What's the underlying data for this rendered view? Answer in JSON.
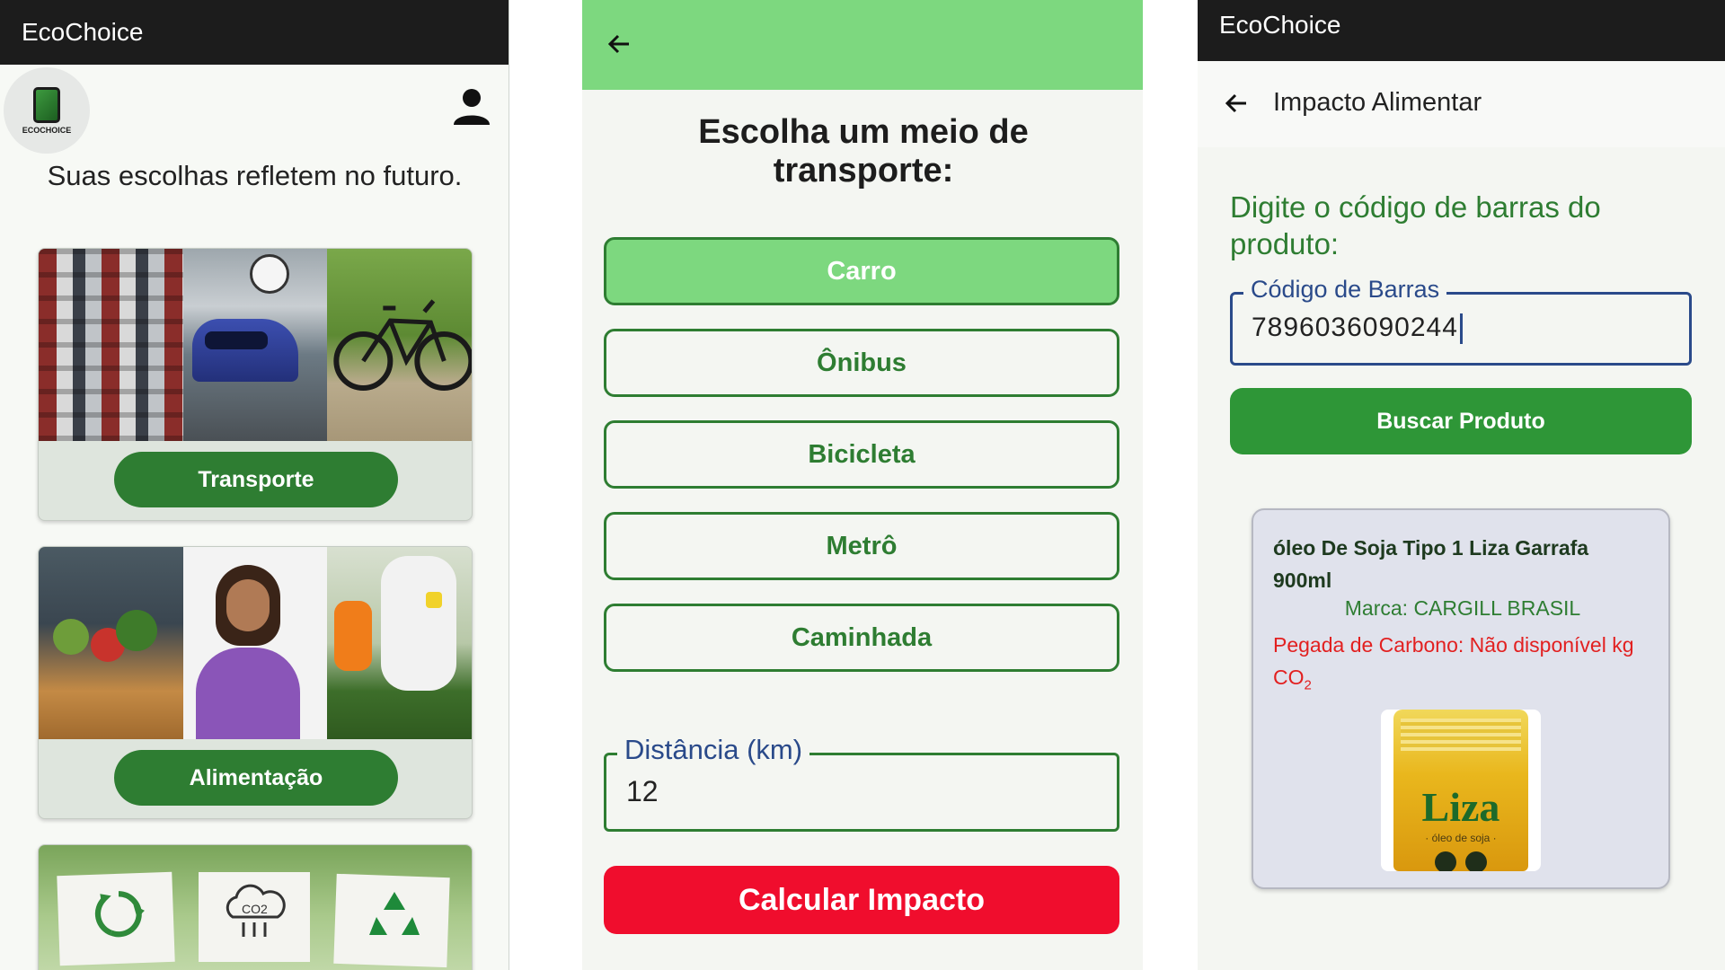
{
  "screen1": {
    "app_title": "EcoChoice",
    "logo_text": "ECOCHOICE",
    "tagline": "Suas escolhas refletem no futuro.",
    "cards": [
      {
        "button_label": "Transporte"
      },
      {
        "button_label": "Alimentação"
      }
    ],
    "icons": [
      "recycle-arrows-icon",
      "co2-cloud-icon",
      "recycle-symbol-icon"
    ],
    "co2_sign_label": "CO2"
  },
  "screen2": {
    "title": "Escolha um meio de transporte:",
    "options": [
      {
        "label": "Carro",
        "selected": true
      },
      {
        "label": "Ônibus",
        "selected": false
      },
      {
        "label": "Bicicleta",
        "selected": false
      },
      {
        "label": "Metrô",
        "selected": false
      },
      {
        "label": "Caminhada",
        "selected": false
      }
    ],
    "distance_label": "Distância (km)",
    "distance_value": "12",
    "calc_button": "Calcular Impacto"
  },
  "screen3": {
    "app_title": "EcoChoice",
    "page_title": "Impacto Alimentar",
    "prompt": "Digite o código de barras do produto:",
    "barcode_label": "Código de Barras",
    "barcode_value": "7896036090244",
    "search_button": "Buscar Produto",
    "product": {
      "name": "óleo De Soja Tipo 1 Liza Garrafa 900ml",
      "brand": "Marca: CARGILL BRASIL",
      "carbon_prefix": "Pegada de Carbono: Não disponível kg CO",
      "carbon_subscript": "2",
      "image_brand": "Liza",
      "image_subtitle": "· óleo de soja ·"
    }
  },
  "colors": {
    "primary_green": "#2e7d32",
    "light_green": "#7dd87f",
    "alert_red": "#f00d2d",
    "dark_bar": "#1c1c1c",
    "field_blue": "#2a4a8a"
  }
}
